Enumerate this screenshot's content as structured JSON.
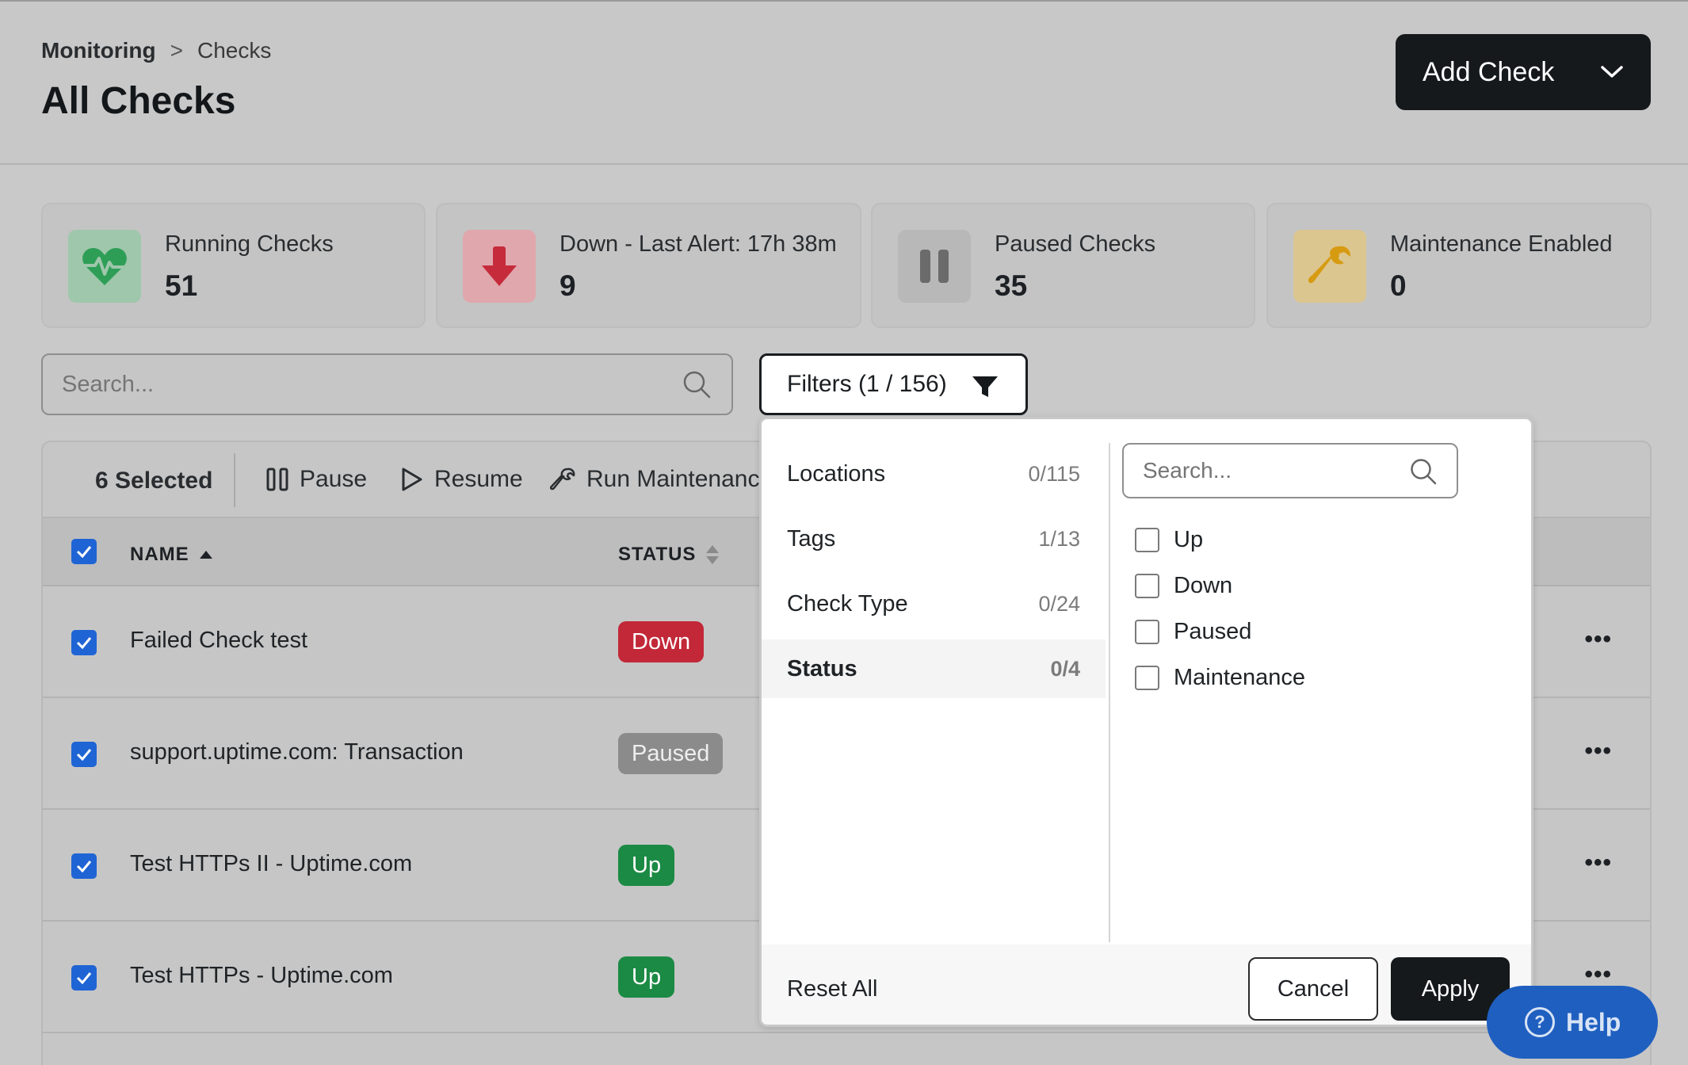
{
  "breadcrumb": {
    "root": "Monitoring",
    "separator": ">",
    "current": "Checks"
  },
  "page_title": "All Checks",
  "add_check": {
    "label": "Add Check"
  },
  "stats": [
    {
      "label": "Running Checks",
      "value": "51",
      "icon": "heartbeat-icon",
      "color": "#2e9e57"
    },
    {
      "label": "Down - Last Alert: 17h 38m",
      "value": "9",
      "icon": "arrow-down-icon",
      "color": "#c62b3b"
    },
    {
      "label": "Paused Checks",
      "value": "35",
      "icon": "pause-icon",
      "color": "#6b6b6b"
    },
    {
      "label": "Maintenance Enabled",
      "value": "0",
      "icon": "wrench-icon",
      "color": "#d79b12"
    }
  ],
  "search": {
    "placeholder": "Search..."
  },
  "filters_button": {
    "label": "Filters (1 / 156)"
  },
  "bulk": {
    "selected": "6 Selected",
    "pause": "Pause",
    "resume": "Resume",
    "maintenance": "Run Maintenanc"
  },
  "columns": {
    "name": "NAME",
    "status": "STATUS"
  },
  "rows": [
    {
      "name": "Failed Check test",
      "status": "Down"
    },
    {
      "name": "support.uptime.com: Transaction",
      "status": "Paused"
    },
    {
      "name": "Test HTTPs II - Uptime.com",
      "status": "Up"
    },
    {
      "name": "Test HTTPs - Uptime.com",
      "status": "Up"
    }
  ],
  "row_menu": "•••",
  "filter_panel": {
    "categories": [
      {
        "label": "Locations",
        "count": "0/115"
      },
      {
        "label": "Tags",
        "count": "1/13"
      },
      {
        "label": "Check Type",
        "count": "0/24"
      },
      {
        "label": "Status",
        "count": "0/4"
      }
    ],
    "search_placeholder": "Search...",
    "options": [
      "Up",
      "Down",
      "Paused",
      "Maintenance"
    ],
    "reset": "Reset All",
    "cancel": "Cancel",
    "apply": "Apply"
  },
  "help": {
    "label": "Help",
    "glyph": "?"
  }
}
